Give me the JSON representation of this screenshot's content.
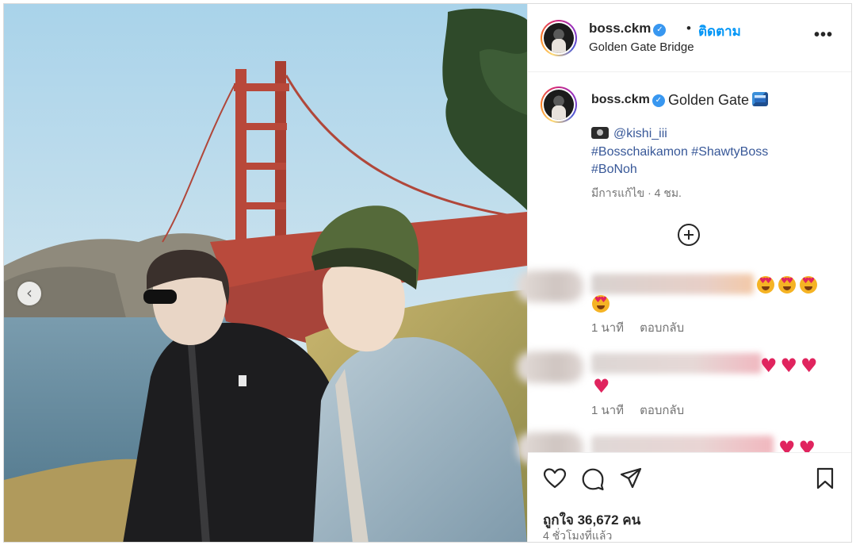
{
  "post": {
    "username": "boss.ckm",
    "separator": "•",
    "follow_label": "ติดตาม",
    "location": "Golden Gate Bridge",
    "more_label": "•••"
  },
  "caption": {
    "username": "boss.ckm",
    "title": "Golden Gate",
    "credit": "@kishi_iii",
    "hashtags_line1": "#Bosschaikamon #ShawtyBoss",
    "hashtags_line2": "#BoNoh",
    "edited": "มีการแก้ไข · 4 ชม."
  },
  "comments": [
    {
      "time": "1 นาที",
      "reply_label": "ตอบกลับ"
    },
    {
      "time": "1 นาที",
      "reply_label": "ตอบกลับ"
    }
  ],
  "footer": {
    "likes": "ถูกใจ 36,672 คน",
    "posted": "4 ชั่วโมงที่แล้ว"
  },
  "icons": {
    "prev": "chevron-left-icon",
    "add_comment": "add-circle-icon",
    "like": "heart-icon",
    "comment": "comment-icon",
    "share": "send-icon",
    "save": "bookmark-icon",
    "verified": "verified-badge-icon"
  },
  "colors": {
    "follow": "#0095f6",
    "hashtag": "#385898",
    "verified": "#3897f0",
    "heart": "#e0245e"
  }
}
